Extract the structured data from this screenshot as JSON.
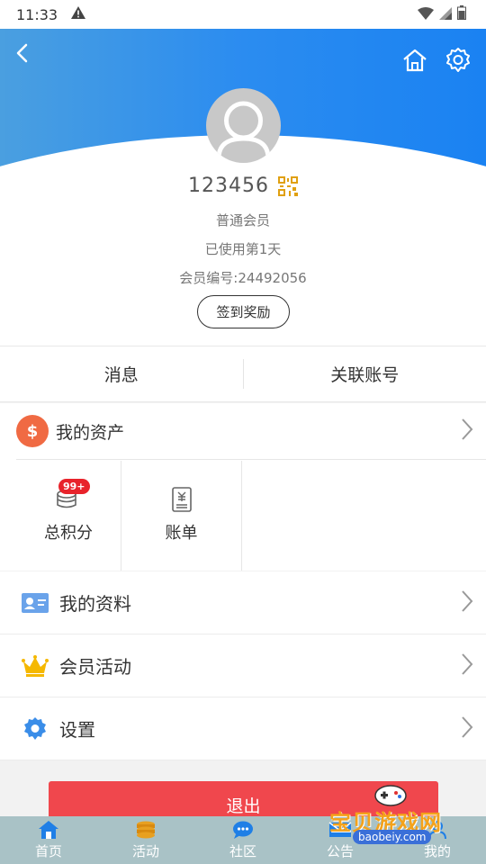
{
  "status_bar": {
    "time": "11:33"
  },
  "profile": {
    "username": "123456",
    "level": "普通会员",
    "days_used": "已使用第1天",
    "member_no": "会员编号:24492056",
    "checkin_label": "签到奖励"
  },
  "tabs": [
    {
      "label": "消息"
    },
    {
      "label": "关联账号"
    }
  ],
  "assets": {
    "title": "我的资产",
    "items": [
      {
        "label": "总积分",
        "badge": "99+"
      },
      {
        "label": "账单"
      }
    ]
  },
  "menu": [
    {
      "label": "我的资料",
      "icon": "id-card-icon"
    },
    {
      "label": "会员活动",
      "icon": "crown-icon"
    },
    {
      "label": "设置",
      "icon": "gear-icon"
    }
  ],
  "logout_label": "退出",
  "bottom_nav": [
    {
      "label": "首页",
      "icon": "home-icon"
    },
    {
      "label": "活动",
      "icon": "coins-icon"
    },
    {
      "label": "社区",
      "icon": "chat-icon"
    },
    {
      "label": "公告",
      "icon": "mail-icon"
    },
    {
      "label": "我的",
      "icon": "user-icon"
    }
  ],
  "watermark": {
    "text": "宝贝游戏网",
    "url": "baobeiy.com"
  },
  "colors": {
    "header": "#2b8cf0",
    "logout": "#f0474d",
    "assets_icon": "#f06a43",
    "crown": "#f5b800",
    "nav_bg": "#a9c2c6"
  }
}
